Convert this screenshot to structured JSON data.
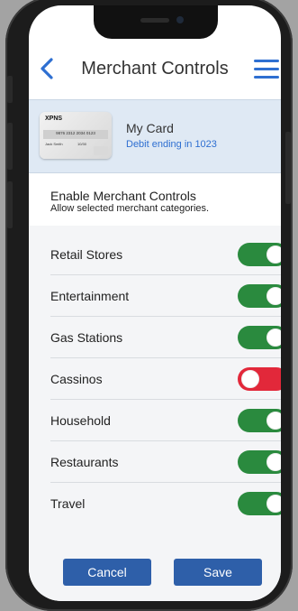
{
  "header": {
    "title": "Merchant Controls",
    "back_icon": "chevron-left-icon",
    "menu_icon": "hamburger-menu-icon"
  },
  "card": {
    "name": "My Card",
    "subtitle": "Debit ending in 1023",
    "image": {
      "brand": "XPNS",
      "number": "9876 2312 2034 0123",
      "holder": "Jack Smith",
      "expiry": "10/30"
    }
  },
  "enable": {
    "title": "Enable Merchant Controls",
    "subtitle": "Allow selected merchant categories."
  },
  "categories": [
    {
      "label": "Retail Stores",
      "enabled": true
    },
    {
      "label": "Entertainment",
      "enabled": true
    },
    {
      "label": "Gas Stations",
      "enabled": true
    },
    {
      "label": "Cassinos",
      "enabled": false
    },
    {
      "label": "Household",
      "enabled": true
    },
    {
      "label": "Restaurants",
      "enabled": true
    },
    {
      "label": "Travel",
      "enabled": true
    }
  ],
  "actions": {
    "cancel_label": "Cancel",
    "save_label": "Save"
  },
  "colors": {
    "accent": "#2e6fd1",
    "toggle_on": "#2a8a3e",
    "toggle_off": "#e2283a",
    "button": "#2e5fa9",
    "card_row_bg": "#dfe9f4"
  }
}
